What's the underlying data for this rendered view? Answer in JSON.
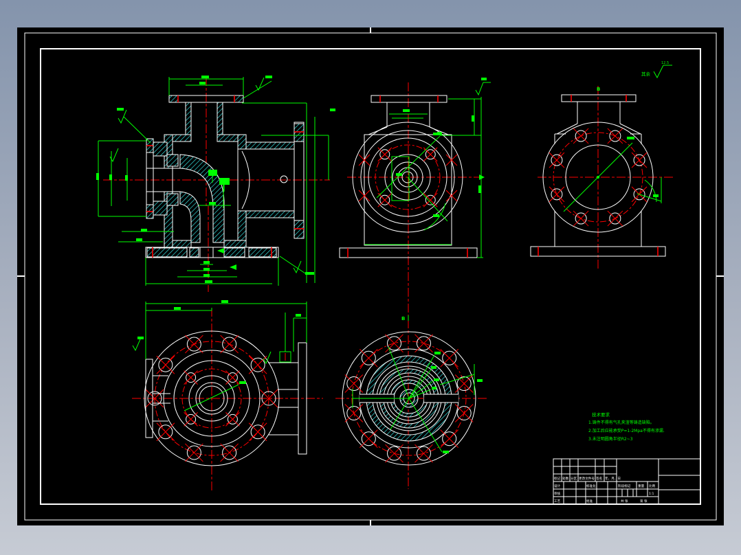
{
  "notes": {
    "title": "技术要求",
    "items": [
      "1.铸件不得有气孔夹渣等铸造缺陷。",
      "2.加工后应能承受P=1-2Mpa不得有渗漏.",
      "3.未注明圆角半径R2~3"
    ]
  },
  "surface_note": {
    "prefix": "其余",
    "value": "12.5"
  },
  "section_labels": {
    "side_top": "B",
    "bottom": "B"
  },
  "title_block": {
    "rev_mark": "标记",
    "rev_count": "处数",
    "rev_zone": "分区",
    "rev_file": "更改文件号",
    "rev_sign": "签名",
    "rev_date": "年、月、日",
    "design": "设计",
    "standardization": "标准化",
    "check": "审核",
    "process": "工艺",
    "approve": "批准",
    "stage_mark": "阶段标记",
    "weight": "重量",
    "scale": "比例",
    "scale_value": "1:1",
    "sheet_total": "共  张",
    "sheet_no": "第  张"
  },
  "colors": {
    "background_top": "#8494ac",
    "background_bottom": "#c6cbd4",
    "sheet": "#000000",
    "outline": "#ffffff",
    "hatch": "#35dede",
    "centerline": "#ff0000",
    "dimension": "#00ff00"
  }
}
